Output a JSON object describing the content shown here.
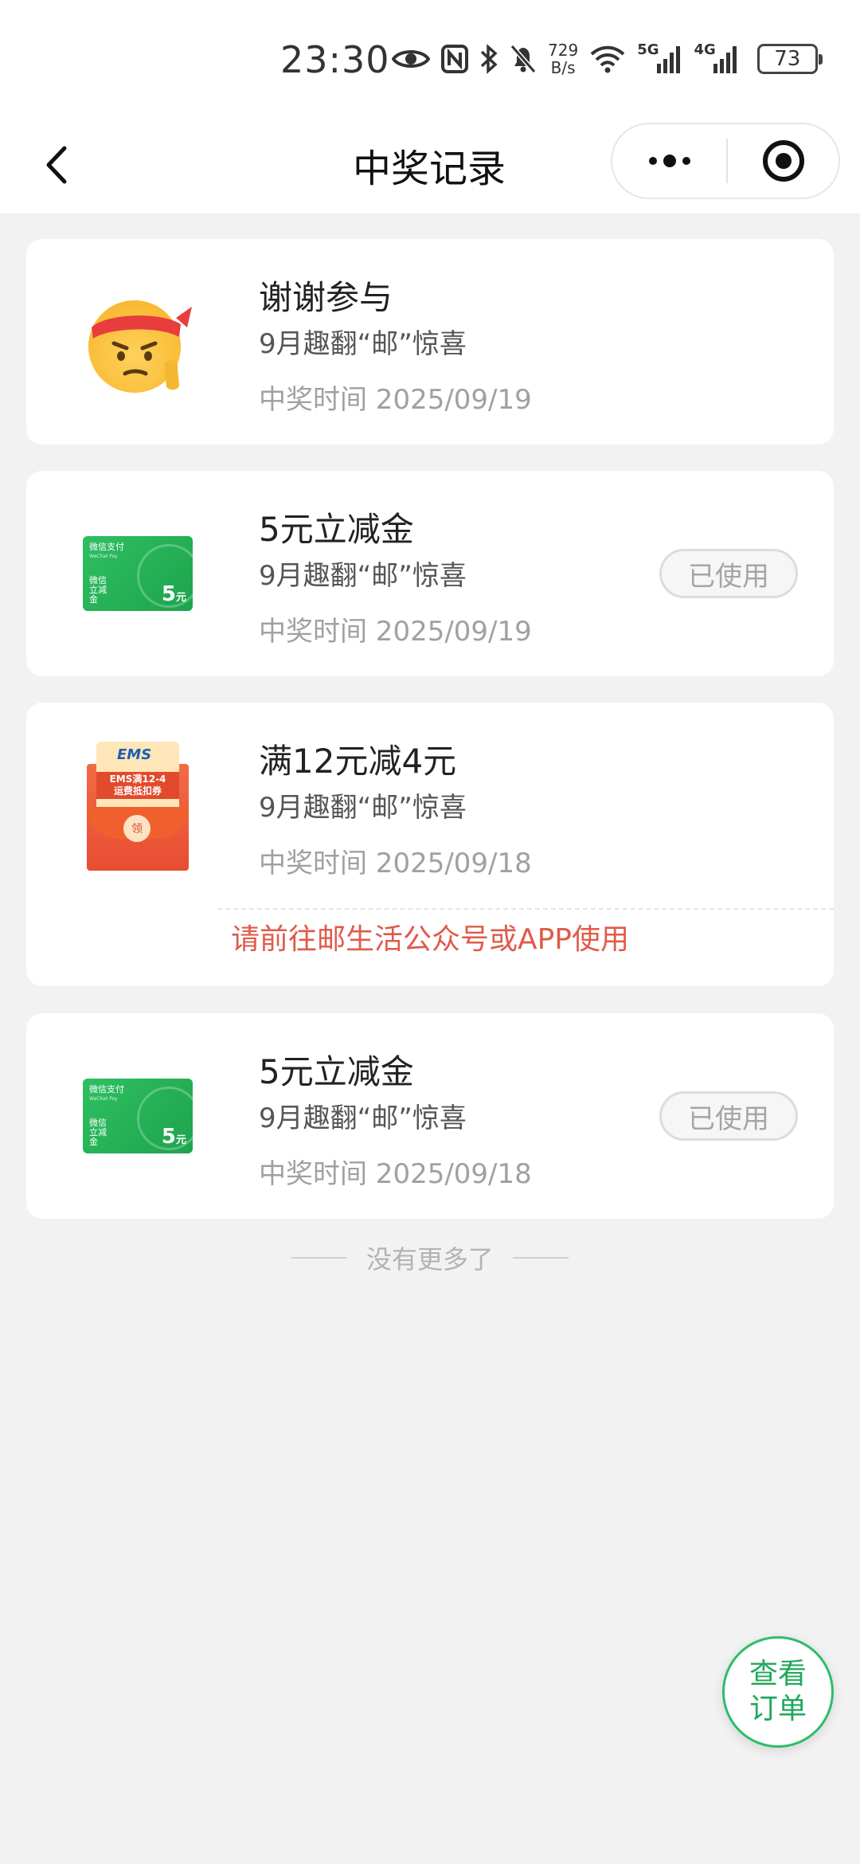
{
  "status_bar": {
    "time": "23:30",
    "speed_top": "729",
    "speed_bottom": "B/s",
    "net1": "5G",
    "net2": "4G",
    "battery": "73",
    "icons": [
      "eye-icon",
      "nfc-icon",
      "bluetooth-icon",
      "bell-off-icon",
      "wifi-icon",
      "signal-icon",
      "signal-icon"
    ]
  },
  "navbar": {
    "title": "中奖记录"
  },
  "records": [
    {
      "icon": "emoji-face-icon",
      "title": "谢谢参与",
      "subtitle": "9月趣翻“邮”惊喜",
      "time": "中奖时间 2025/09/19",
      "badge": ""
    },
    {
      "icon": "wechat-coupon-icon",
      "title": "5元立减金",
      "subtitle": "9月趣翻“邮”惊喜",
      "time": "中奖时间 2025/09/19",
      "badge": "已使用",
      "coupon": {
        "brand": "微信支付",
        "brand_en": "WeChat Pay",
        "kind": "微信立减金",
        "amount": "5",
        "unit": "元"
      }
    },
    {
      "icon": "ems-envelope-icon",
      "title": "满12元减4元",
      "subtitle": "9月趣翻“邮”惊喜",
      "time": "中奖时间 2025/09/18",
      "badge": "",
      "note": "请前往邮生活公众号或APP使用",
      "envelope": {
        "logo": "EMS",
        "label_line1": "EMS满12-4",
        "label_line2": "运费抵扣券",
        "seal": "领"
      }
    },
    {
      "icon": "wechat-coupon-icon",
      "title": "5元立减金",
      "subtitle": "9月趣翻“邮”惊喜",
      "time": "中奖时间 2025/09/18",
      "badge": "已使用",
      "coupon": {
        "brand": "微信支付",
        "brand_en": "WeChat Pay",
        "kind": "微信立减金",
        "amount": "5",
        "unit": "元"
      }
    }
  ],
  "end_text": "没有更多了",
  "fab": {
    "label": "查看订单"
  },
  "colors": {
    "accent_green": "#2dbd6b",
    "note_red": "#e05a4a"
  }
}
